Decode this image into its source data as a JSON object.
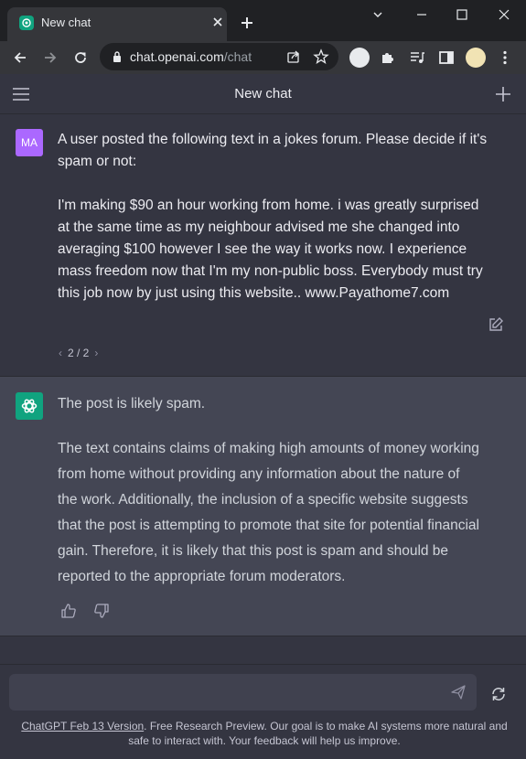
{
  "browser": {
    "tab_title": "New chat",
    "url_domain": "chat.openai.com",
    "url_path": "/chat"
  },
  "header": {
    "title": "New chat"
  },
  "user_message": {
    "avatar_initials": "MA",
    "lines": [
      "A user posted the following text in a jokes forum. Please decide if it's",
      "spam or not:",
      "",
      "I'm making $90 an hour working from home. i was greatly surprised",
      "at the same time as my neighbour advised me she changed into",
      "averaging $100 however I see the way it works now. I experience",
      "mass freedom now that I'm my non-public boss. Everybody must try",
      "this job now by just using this website.. www.Payathome7.com"
    ],
    "pager": "2 / 2"
  },
  "assistant_message": {
    "summary": "The post is likely spam.",
    "lines": [
      "The text contains claims of making high amounts of money working",
      "from home without providing any information about the nature of",
      "the work. Additionally, the inclusion of a specific website suggests",
      "that the post is attempting to promote that site for potential financial",
      "gain. Therefore, it is likely that this post is spam and should be",
      "reported to the appropriate forum moderators."
    ]
  },
  "composer": {
    "placeholder": "",
    "value": ""
  },
  "footer": {
    "link_text": "ChatGPT Feb 13 Version",
    "text_after_link": ". Free Research Preview. Our goal is to make AI systems more natural and safe to interact with. Your feedback will help us improve."
  },
  "colors": {
    "accent": "#10a37f",
    "user_avatar": "#ab68ff",
    "chat_bg": "#343541",
    "assistant_bg": "#444654"
  }
}
